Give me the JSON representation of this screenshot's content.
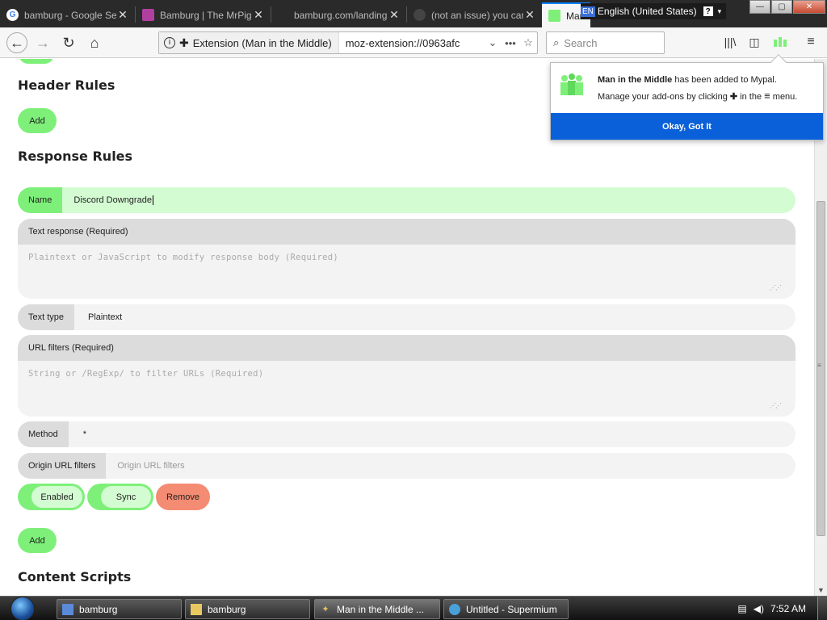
{
  "browser": {
    "tabs": [
      {
        "title": "bamburg - Google Search",
        "icon": "google-icon"
      },
      {
        "title": "Bamburg | The MrPiglr",
        "icon": "site-icon"
      },
      {
        "title": "bamburg.com/landing",
        "icon": "page-icon"
      },
      {
        "title": "(not an issue) you can",
        "icon": "github-icon"
      },
      {
        "title": "Man in the Middle",
        "icon": "mitm-extension-icon"
      }
    ],
    "language_bar": {
      "code": "EN",
      "label": "English (United States)",
      "help": "?"
    },
    "identity_label": "Extension (Man in the Middle)",
    "url": "moz-extension://0963afc",
    "search_placeholder": "Search"
  },
  "page": {
    "header_rules_title": "Header Rules",
    "add_label": "Add",
    "response_rules_title": "Response Rules",
    "name_label": "Name",
    "name_value": "Discord Downgrade",
    "text_response_label": "Text response (Required)",
    "text_response_placeholder": "Plaintext or JavaScript to modify response body (Required)",
    "text_type_label": "Text type",
    "text_type_value": "Plaintext",
    "url_filters_label": "URL filters (Required)",
    "url_filters_placeholder": "String or /RegExp/ to filter URLs (Required)",
    "method_label": "Method",
    "method_value": "*",
    "origin_label": "Origin URL filters",
    "origin_placeholder": "Origin URL filters",
    "enabled_label": "Enabled",
    "sync_label": "Sync",
    "remove_label": "Remove",
    "add_response_label": "Add",
    "content_scripts_title": "Content Scripts"
  },
  "notification": {
    "addon_name": "Man in the Middle",
    "line1_suffix": " has been added to Mypal.",
    "line2_prefix": "Manage your add-ons by clicking ",
    "line2_mid": " in the ",
    "line2_suffix": " menu.",
    "button": "Okay, Got It"
  },
  "taskbar": {
    "items": [
      {
        "label": "bamburg",
        "icon": "computer-icon"
      },
      {
        "label": "bamburg",
        "icon": "folder-icon"
      },
      {
        "label": "Man in the Middle ...",
        "icon": "browser-icon"
      },
      {
        "label": "Untitled - Supermium",
        "icon": "supermium-icon"
      }
    ],
    "clock": "7:52 AM"
  },
  "colors": {
    "accent_green": "#7ef07a",
    "light_green": "#d4fcd2",
    "remove_red": "#f48b73",
    "notification_blue": "#0a60d8"
  }
}
